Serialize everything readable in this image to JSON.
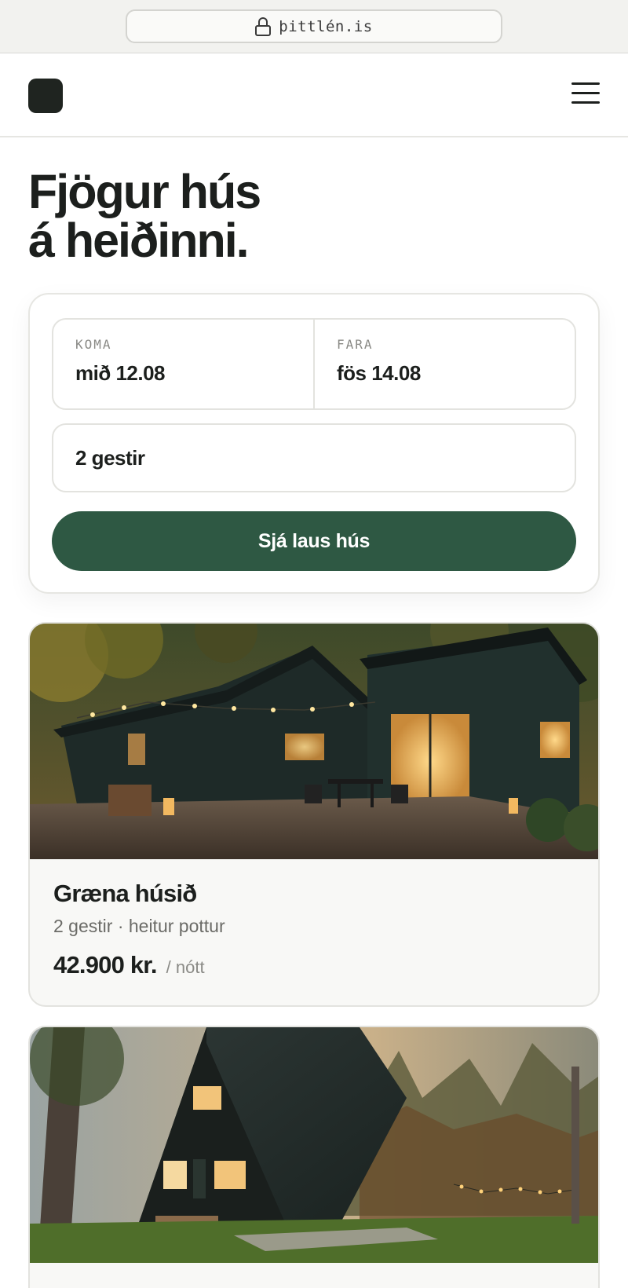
{
  "browser": {
    "url": "þittlén.is"
  },
  "header": {
    "logo_icon": "logo-square",
    "menu_icon": "hamburger-menu-icon"
  },
  "hero": {
    "title_line1": "Fjögur hús",
    "title_line2": "á heiðinni."
  },
  "search": {
    "arrival_label": "KOMA",
    "arrival_value": "mið 12.08",
    "departure_label": "FARA",
    "departure_value": "fös 14.08",
    "guests_value": "2 gestir",
    "cta_label": "Sjá laus hús",
    "cta_color": "#2e5843"
  },
  "listings": [
    {
      "name": "Græna húsið",
      "meta": "2 gestir · heitur pottur",
      "price": "42.900 kr.",
      "unit": "/ nótt"
    }
  ]
}
